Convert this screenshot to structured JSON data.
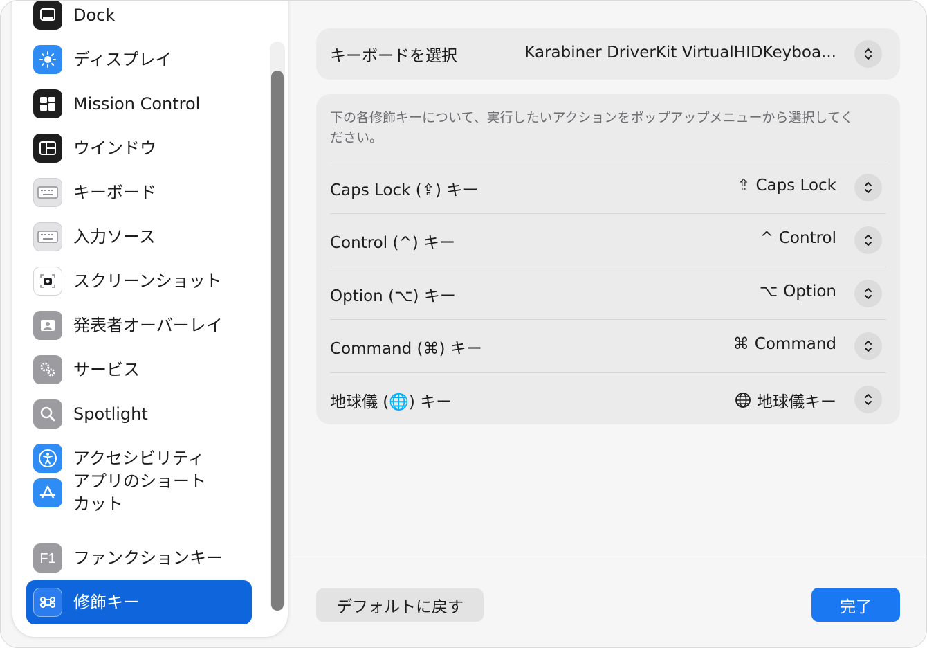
{
  "sidebar": {
    "items": [
      {
        "label": "Dock",
        "icon": "dock-icon"
      },
      {
        "label": "ディスプレイ",
        "icon": "display-brightness-icon"
      },
      {
        "label": "Mission Control",
        "icon": "mission-control-icon"
      },
      {
        "label": "ウインドウ",
        "icon": "window-icon"
      },
      {
        "label": "キーボード",
        "icon": "keyboard-icon"
      },
      {
        "label": "入力ソース",
        "icon": "input-sources-icon"
      },
      {
        "label": "スクリーンショット",
        "icon": "screenshot-camera-icon"
      },
      {
        "label": "発表者オーバーレイ",
        "icon": "presenter-overlay-icon"
      },
      {
        "label": "サービス",
        "icon": "services-gear-icon"
      },
      {
        "label": "Spotlight",
        "icon": "spotlight-magnifier-icon"
      },
      {
        "label": "アクセシビリティ",
        "icon": "accessibility-icon"
      },
      {
        "label": "アプリのショートカット",
        "icon": "app-store-icon"
      },
      {
        "label": "ファンクションキー",
        "icon": "function-key-icon"
      },
      {
        "label": "修飾キー",
        "icon": "command-key-icon",
        "selected": true
      }
    ]
  },
  "keyboard_select": {
    "label": "キーボードを選択",
    "value": "Karabiner DriverKit VirtualHIDKeyboa..."
  },
  "modifiers": {
    "description": "下の各修飾キーについて、実行したいアクションをポップアップメニューから選択してください。",
    "rows": [
      {
        "label": "Caps Lock (⇪) キー",
        "symbol": "⇪",
        "value": "Caps Lock"
      },
      {
        "label": "Control (^) キー",
        "symbol": "^",
        "value": "Control"
      },
      {
        "label": "Option (⌥) キー",
        "symbol": "⌥",
        "value": "Option"
      },
      {
        "label": "Command (⌘) キー",
        "symbol": "⌘",
        "value": "Command"
      },
      {
        "label": "地球儀 (🌐) キー",
        "symbol": "globe",
        "value": "地球儀キー"
      }
    ]
  },
  "footer": {
    "restore_label": "デフォルトに戻す",
    "done_label": "完了"
  },
  "colors": {
    "accent": "#1a78f2",
    "selected_sidebar": "#0f66dc"
  }
}
